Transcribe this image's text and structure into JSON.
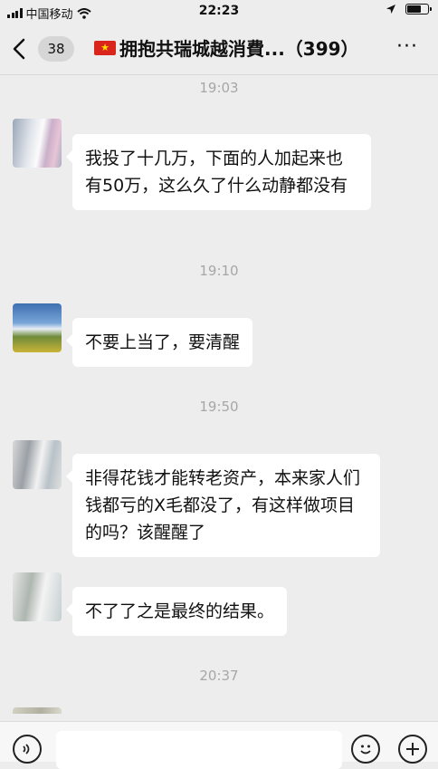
{
  "status_bar": {
    "carrier": "中国移动",
    "time": "22:23",
    "battery_fraction": 0.7,
    "icons": [
      "signal-icon",
      "wifi-icon",
      "location-arrow-icon",
      "battery-icon"
    ]
  },
  "header": {
    "back_icon": "chevron-left-icon",
    "unread_count": "38",
    "flag_icon": "vietnam-flag-icon",
    "title": "拥抱共瑞城越消費...（399）",
    "more_label": "···"
  },
  "messages": [
    {
      "type": "time",
      "text": "19:03"
    },
    {
      "type": "message",
      "text": "我投了十几万，下面的人加起来也有50万，这么久了什么动静都没有"
    },
    {
      "type": "time",
      "text": "19:10"
    },
    {
      "type": "message",
      "text": "不要上当了，要清醒"
    },
    {
      "type": "time",
      "text": "19:50"
    },
    {
      "type": "message",
      "text": "非得花钱才能转老资产，本来家人们钱都亏的X毛都没了，有这样做项目的吗？该醒醒了"
    },
    {
      "type": "message",
      "text": "不了了之是最终的结果。"
    },
    {
      "type": "time",
      "text": "20:37"
    }
  ],
  "input_bar": {
    "voice_icon": "voice-icon",
    "emoji_icon": "emoji-icon",
    "plus_icon": "plus-icon",
    "placeholder": ""
  },
  "colors": {
    "background": "#ededed",
    "bubble": "#ffffff",
    "timestamp": "#a7a7a7"
  }
}
